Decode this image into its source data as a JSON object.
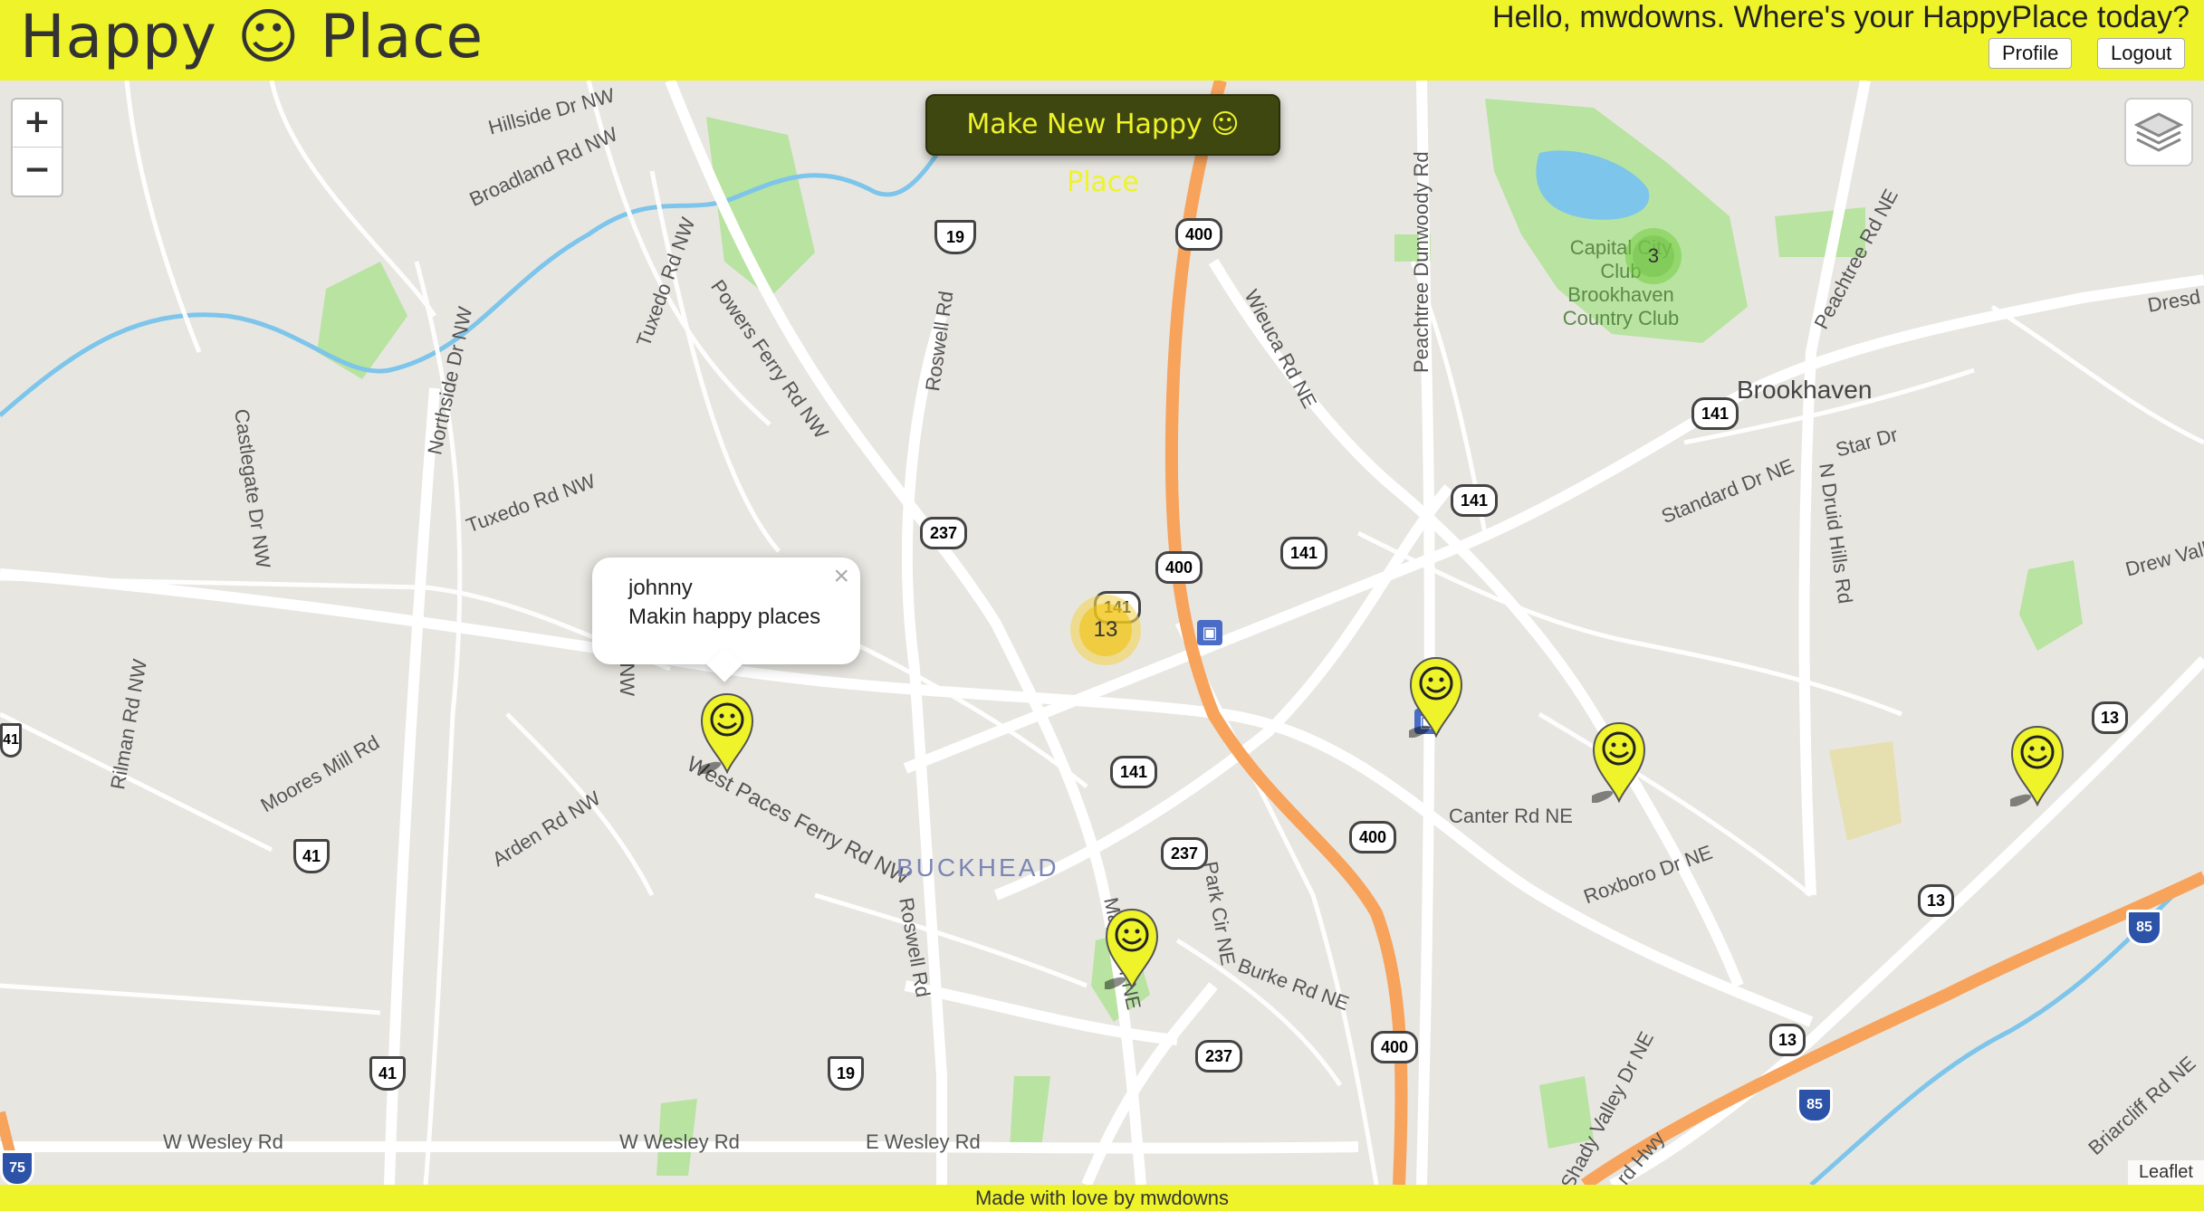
{
  "header": {
    "logo": "Happy ☺ Place",
    "greeting": "Hello, mwdowns. Where's your HappyPlace today?",
    "profile_label": "Profile",
    "logout_label": "Logout"
  },
  "map": {
    "make_button_label": "Make New Happy ☺ Place",
    "zoom_in": "+",
    "zoom_out": "−",
    "attribution": "Leaflet",
    "popup": {
      "name": "johnny",
      "text": "Makin happy places",
      "close": "×"
    },
    "clusters": [
      "13",
      "3"
    ],
    "labels": {
      "hillside": "Hillside Dr NW",
      "broadland": "Broadland Rd NW",
      "tuxedo1": "Tuxedo Rd NW",
      "powers": "Powers Ferry Rd NW",
      "roswell1": "Roswell Rd",
      "northside": "Northside Dr NW",
      "castlegate": "Castlegate Dr NW",
      "tuxedo2": "Tuxedo Rd NW",
      "wieuca": "Wieuca Rd NE",
      "peachtree_dun": "Peachtree Dunwoody Rd",
      "capital": "Capital City Club Brookhaven Country Club",
      "peachtree_rd": "Peachtree Rd NE",
      "brookhaven": "Brookhaven",
      "standard": "Standard Dr NE",
      "star": "Star Dr",
      "ndruid": "N Druid Hills Rd",
      "drewvalley": "Drew Valley",
      "dresden": "Dresd",
      "moores": "Moores Mill Rd",
      "rilman": "Rilman Rd NW",
      "arden": "Arden Rd NW",
      "wpaces": "West Paces Ferry Rd NW",
      "buckhead": "BUCKHEAD",
      "roswell2": "Roswell Rd",
      "maple": "Maple Dr NE",
      "park": "Park Cir NE",
      "canter": "Canter Rd NE",
      "roxboro": "Roxboro Dr NE",
      "burke": "Burke Rd NE",
      "wwesley1": "W Wesley Rd",
      "wwesley2": "W Wesley Rd",
      "ewesley": "E Wesley Rd",
      "shady": "Shady Valley Dr NE",
      "briarcliff": "Briarcliff Rd NE",
      "hwy": "rd Hwy",
      "mwnw": "Mw NW"
    },
    "shields": [
      "400",
      "19",
      "237",
      "141",
      "400",
      "141",
      "141",
      "141",
      "141",
      "400",
      "237",
      "237",
      "400",
      "13",
      "13",
      "13",
      "41",
      "41",
      "19",
      "85",
      "85",
      "75",
      "41"
    ]
  },
  "footer": {
    "text": "Made with love by mwdowns"
  },
  "colors": {
    "accent": "#eef32a",
    "button_dark": "#3f4710",
    "highway": "#f7a35c",
    "water": "#7dc5ea",
    "park": "#b8e3a0"
  }
}
